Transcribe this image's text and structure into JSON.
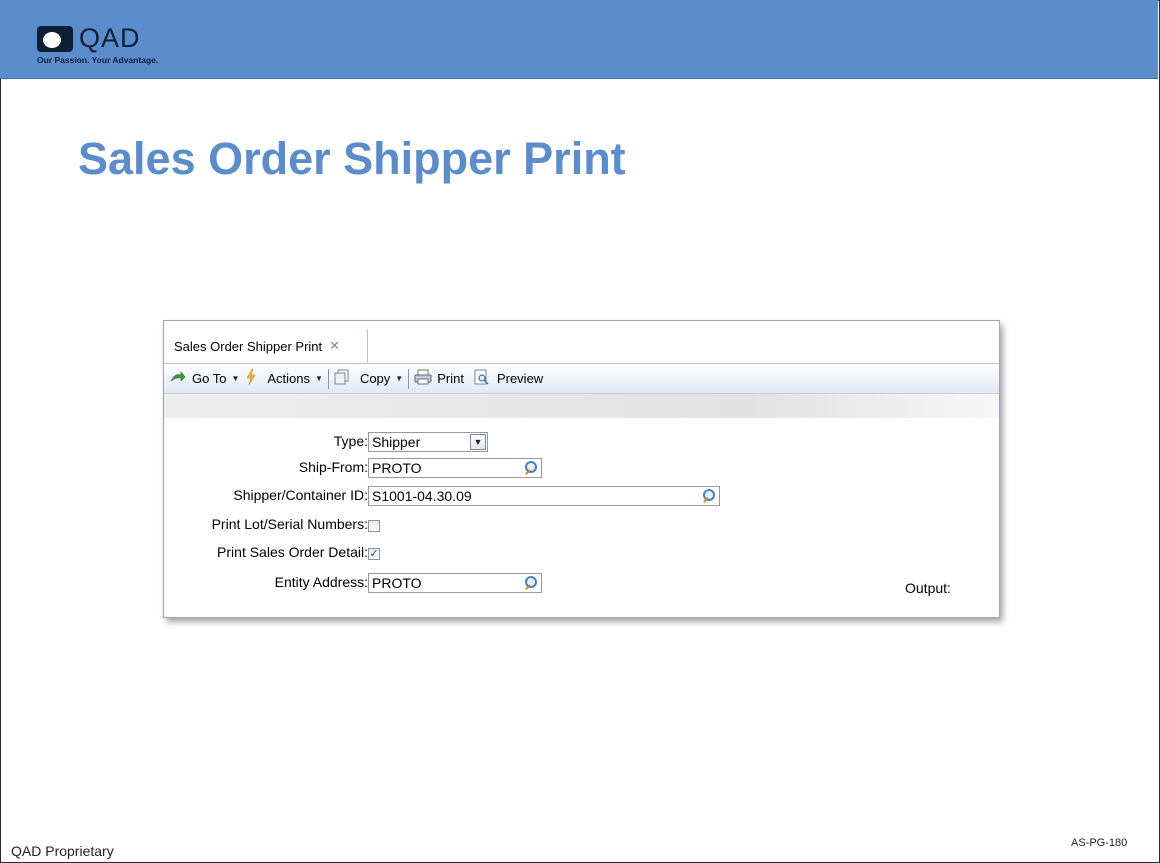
{
  "header": {
    "brand": "QAD",
    "tagline": "Our Passion. Your Advantage."
  },
  "slide": {
    "title": "Sales Order Shipper Print"
  },
  "window": {
    "tab_label": "Sales Order Shipper Print",
    "tab_close": "✕",
    "toolbar": {
      "goto": "Go To",
      "actions": "Actions",
      "copy": "Copy",
      "print": "Print",
      "preview": "Preview"
    },
    "form": {
      "type_label": "Type:",
      "type_value": "Shipper",
      "ship_from_label": "Ship-From:",
      "ship_from_value": "PROTO",
      "shipper_id_label": "Shipper/Container ID:",
      "shipper_id_value": "S1001-04.30.09",
      "print_lot_label": "Print Lot/Serial Numbers:",
      "print_lot_checked": false,
      "print_so_detail_label": "Print Sales Order Detail:",
      "print_so_detail_checked": true,
      "entity_label": "Entity Address:",
      "entity_value": "PROTO",
      "output_label": "Output:"
    }
  },
  "footer": {
    "left": "QAD Proprietary",
    "right": "AS-PG-180"
  },
  "colors": {
    "header_bg": "#5b8ccc",
    "title": "#5b8ccc",
    "brand_dark": "#0e1f36"
  }
}
